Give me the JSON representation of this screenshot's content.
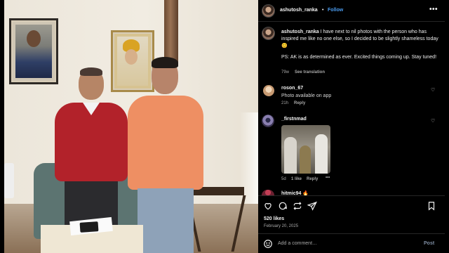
{
  "post": {
    "author": "ashutosh_ranka",
    "separator": "•",
    "follow_label": "Follow",
    "more_label": "•••",
    "caption_user": "ashutosh_ranka",
    "caption_line1": " I have next to nil photos with the person who has inspired me like no one else, so I decided to be slightly shameless today 😊",
    "caption_line2": "PS: AK is as determined as ever. Excited things coming up. Stay tuned!",
    "caption_age": "79w",
    "see_translation": "See translation"
  },
  "comments": [
    {
      "user": "roson_67",
      "text": "Photo available on app",
      "age": "21h",
      "reply": "Reply"
    },
    {
      "user": "_firstnmad",
      "age": "5d",
      "likes": "1 like",
      "reply": "Reply",
      "more": "•••"
    },
    {
      "user": "hitmic94 🔥"
    }
  ],
  "actions": {
    "icons": [
      "heart-icon",
      "comment-icon",
      "repost-icon",
      "share-icon",
      "bookmark-icon"
    ],
    "likes": "520 likes",
    "date": "February 20, 2025"
  },
  "composer": {
    "placeholder": "Add a comment…",
    "post_label": "Post"
  },
  "colors": {
    "background": "#000000",
    "accent": "#4c9ef2",
    "muted_text": "#a8a8a8"
  }
}
